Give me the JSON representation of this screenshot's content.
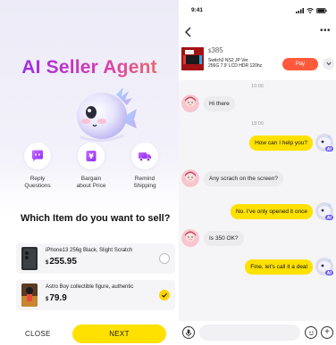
{
  "left": {
    "title": "AI Seller Agent",
    "features": [
      {
        "label_line1": "Reply",
        "label_line2": "Questions",
        "icon": "chat-bubble-icon",
        "color": "#a24cf0"
      },
      {
        "label_line1": "Bargain",
        "label_line2": "about Price",
        "icon": "yen-tag-icon",
        "color": "#a24cf0"
      },
      {
        "label_line1": "Remind",
        "label_line2": "Shipping",
        "icon": "delivery-truck-icon",
        "color": "#a24cf0"
      }
    ],
    "question": "Which Item do you want to sell?",
    "items": [
      {
        "name": "iPhone13 256g Black, Slight Scratch",
        "currency": "$",
        "price": "255.95",
        "selected": false
      },
      {
        "name": "Astro Boy collectible figure, authentic",
        "currency": "$",
        "price": "79.9",
        "selected": true
      }
    ],
    "close_label": "CLOSE",
    "next_label": "NEXT"
  },
  "right": {
    "status_time": "9:41",
    "product": {
      "currency": "$",
      "price": "385",
      "name_line1": "Switch2 NS2 JP Ver",
      "name_line2": "256G 7.9' LCD HDR 120hz",
      "pay_label": "Pay"
    },
    "timestamps": [
      "10:00",
      "18:00"
    ],
    "messages": [
      {
        "from": "buyer",
        "text": "Hi there"
      },
      {
        "from": "agent",
        "text": "How can I help you?"
      },
      {
        "from": "buyer",
        "text": "Any scrach on the screen?"
      },
      {
        "from": "agent",
        "text": "No. I've only opened it once"
      },
      {
        "from": "buyer",
        "text": "Is 350 OK?"
      },
      {
        "from": "agent",
        "text": "Fine, let's call it a deal"
      }
    ],
    "bot_badge": "AI"
  },
  "colors": {
    "accent_yellow": "#ffe100",
    "pay_red": "#ff5a3c",
    "title_gradient_start": "#8d2cf2",
    "title_gradient_end": "#f07a5a"
  }
}
